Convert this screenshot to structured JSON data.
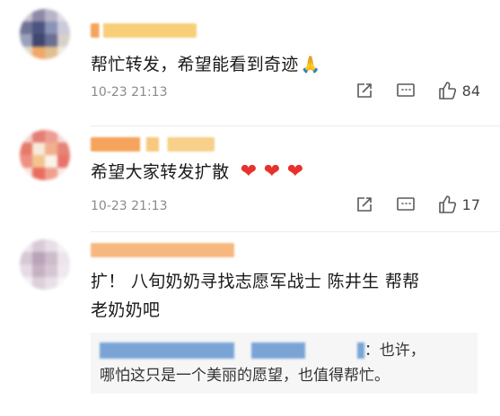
{
  "comments": [
    {
      "text": "帮忙转发，希望能看到奇迹",
      "emoji": "🙏",
      "time": "10-23 21:13",
      "like_count": "84"
    },
    {
      "text": "希望大家转发扩散",
      "hearts": "❤ ❤ ❤",
      "time": "10-23 21:13",
      "like_count": "17"
    },
    {
      "text_line1": "扩！ 八旬奶奶寻找志愿军战士 陈井生 帮帮",
      "text_line2": "老奶奶吧",
      "quote_line1_end": "：也许，",
      "quote_line2": "哪怕这只是一个美丽的愿望，也值得帮忙。"
    }
  ],
  "icons": {
    "share": "share-icon",
    "comment": "comment-icon",
    "like": "like-icon"
  },
  "colors": {
    "heart": "#e8312c",
    "meta": "#8a8a8a"
  }
}
